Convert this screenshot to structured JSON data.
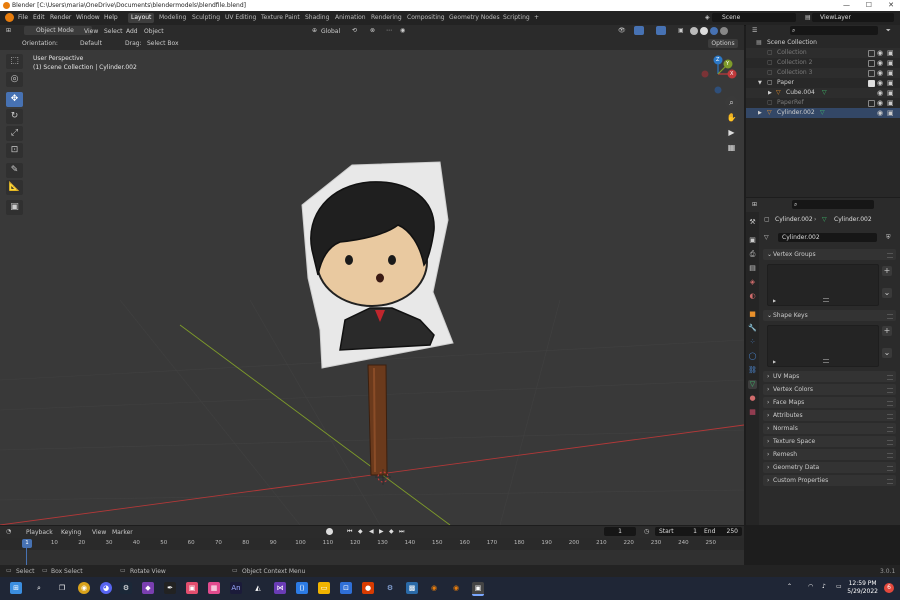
{
  "window": {
    "title": "Blender [C:\\Users\\maria\\OneDrive\\Documents\\blendermodels\\blendfile.blend]"
  },
  "menubar": {
    "menus": [
      "File",
      "Edit",
      "Render",
      "Window",
      "Help"
    ],
    "workspace_tabs": [
      "Layout",
      "Modeling",
      "Sculpting",
      "UV Editing",
      "Texture Paint",
      "Shading",
      "Animation",
      "Rendering",
      "Compositing",
      "Geometry Nodes",
      "Scripting"
    ],
    "active_tab": "Layout",
    "add_tab": "+",
    "scene": "Scene",
    "view_layer": "ViewLayer"
  },
  "viewport_header": {
    "mode": "Object Mode",
    "menus": [
      "View",
      "Select",
      "Add",
      "Object"
    ],
    "transform_orientation": "Global",
    "options": "Options"
  },
  "tool_header": {
    "orientation_label": "Orientation:",
    "orientation_value": "Default",
    "drag_label": "Drag:",
    "drag_value": "Select Box"
  },
  "viewport": {
    "perspective": "User Perspective",
    "collection_info": "(1) Scene Collection | Cylinder.002",
    "gizmo": {
      "z": "Z",
      "y": "Y",
      "x": "X"
    }
  },
  "outliner": {
    "root": "Scene Collection",
    "rows": [
      {
        "label": "Collection",
        "dim": true,
        "indent": 0
      },
      {
        "label": "Collection 2",
        "dim": true,
        "indent": 0
      },
      {
        "label": "Collection 3",
        "dim": true,
        "indent": 0
      },
      {
        "label": "Paper",
        "dim": false,
        "indent": 0,
        "expand": true,
        "checked": true
      },
      {
        "label": "Cube.004",
        "dim": false,
        "indent": 1,
        "expand": true
      },
      {
        "label": "PaperRef",
        "dim": true,
        "indent": 0
      },
      {
        "label": "Cylinder.002",
        "dim": false,
        "indent": 0,
        "expand": true
      }
    ]
  },
  "properties": {
    "breadcrumb_object": "Cylinder.002",
    "breadcrumb_data": "Cylinder.002",
    "mesh_name": "Cylinder.002",
    "panels": {
      "vertex_groups": "Vertex Groups",
      "shape_keys": "Shape Keys",
      "uv_maps": "UV Maps",
      "vertex_colors": "Vertex Colors",
      "face_maps": "Face Maps",
      "attributes": "Attributes",
      "normals": "Normals",
      "texture_space": "Texture Space",
      "remesh": "Remesh",
      "geometry_data": "Geometry Data",
      "custom_properties": "Custom Properties"
    }
  },
  "timeline": {
    "menus": [
      "Playback",
      "Keying",
      "View",
      "Marker"
    ],
    "current_frame": "1",
    "start_label": "Start",
    "start": "1",
    "end_label": "End",
    "end": "250",
    "ticks": [
      "0",
      "10",
      "20",
      "30",
      "40",
      "50",
      "60",
      "70",
      "80",
      "90",
      "100",
      "110",
      "120",
      "130",
      "140",
      "150",
      "160",
      "170",
      "180",
      "190",
      "200",
      "210",
      "220",
      "230",
      "240",
      "250"
    ],
    "playhead": "1"
  },
  "statusbar": {
    "select": "Select",
    "box_select": "Box Select",
    "rotate_view": "Rotate View",
    "context_menu": "Object Context Menu",
    "version": "3.0.1"
  },
  "taskbar": {
    "time": "12:59 PM",
    "date": "5/29/2022"
  },
  "colors": {
    "accent": "#4772b3",
    "viewport_bg": "#393939",
    "axis_x": "#c0393b",
    "axis_y": "#7e9b2a"
  }
}
